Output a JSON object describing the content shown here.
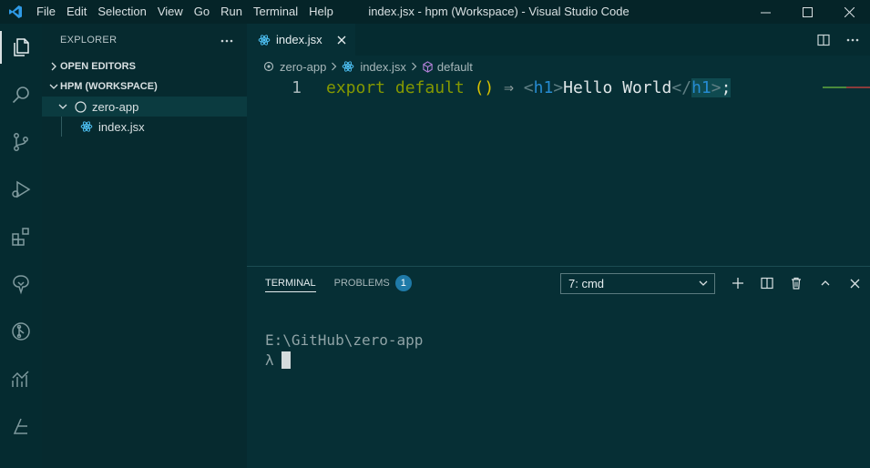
{
  "menu": [
    "File",
    "Edit",
    "Selection",
    "View",
    "Go",
    "Run",
    "Terminal",
    "Help"
  ],
  "window_title": "index.jsx - hpm (Workspace) - Visual Studio Code",
  "sidebar": {
    "title": "EXPLORER",
    "sections": {
      "open_editors": "OPEN EDITORS",
      "workspace": "HPM (WORKSPACE)"
    },
    "folder": "zero-app",
    "file": "index.jsx"
  },
  "editor": {
    "tab_label": "index.jsx",
    "breadcrumbs": [
      "zero-app",
      "index.jsx",
      "default"
    ],
    "line_number": "1",
    "code": {
      "kw1": "export",
      "kw2": "default",
      "parens": "()",
      "arrow": "⇒",
      "lt": "<",
      "tag_open": "h1",
      "gt": ">",
      "text": "Hello World",
      "lt_close": "</",
      "tag_close": "h1",
      "gt_close": ">",
      "semi": ";"
    }
  },
  "panel": {
    "tabs": [
      "TERMINAL",
      "PROBLEMS"
    ],
    "problems_count": "1",
    "terminal_select": "7: cmd",
    "terminal_lines": [
      "E:\\GitHub\\zero-app",
      "λ"
    ]
  },
  "colors": {
    "accent_blue": "#1f7aa8",
    "keyword": "#859900",
    "tag": "#268bd2",
    "paren": "#d9c300",
    "background": "#062f35"
  }
}
